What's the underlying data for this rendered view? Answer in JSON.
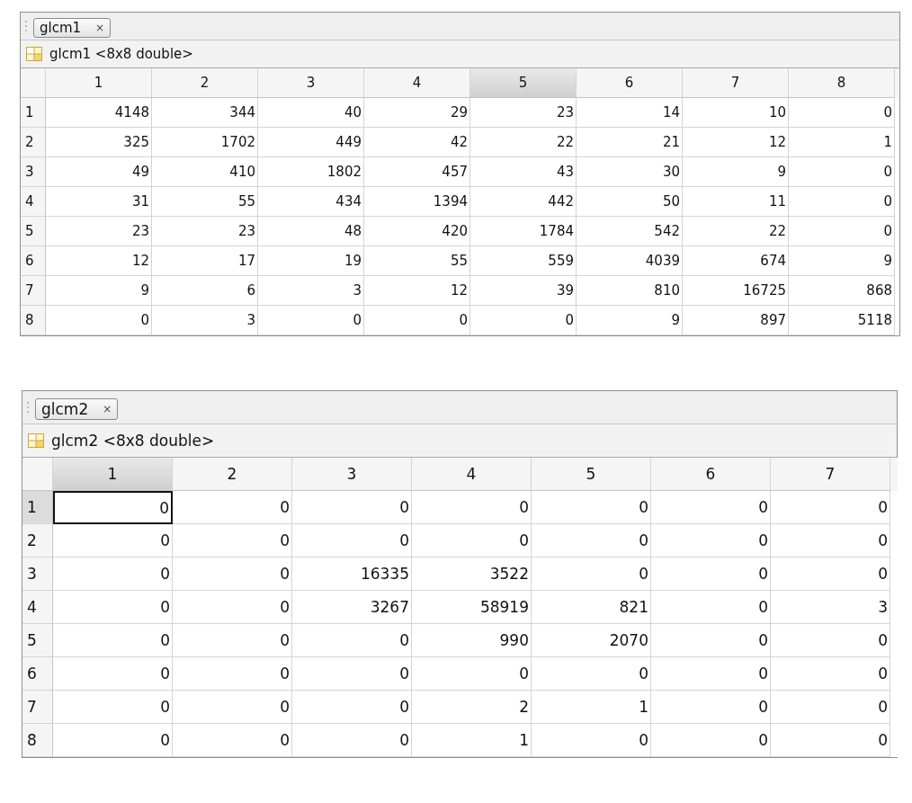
{
  "panels": [
    {
      "tab": {
        "label": "glcm1",
        "close": "×"
      },
      "title": "glcm1 <8x8 double>",
      "columns": [
        {
          "label": "1",
          "selected": false
        },
        {
          "label": "2",
          "selected": false
        },
        {
          "label": "3",
          "selected": false
        },
        {
          "label": "4",
          "selected": false
        },
        {
          "label": "5",
          "selected": true
        },
        {
          "label": "6",
          "selected": false
        },
        {
          "label": "7",
          "selected": false
        },
        {
          "label": "8",
          "selected": false
        }
      ],
      "rows": [
        {
          "label": "1",
          "selected": false,
          "cells": [
            {
              "value": "4148",
              "selected": false
            },
            {
              "value": "344",
              "selected": false
            },
            {
              "value": "40",
              "selected": false
            },
            {
              "value": "29",
              "selected": false
            },
            {
              "value": "23",
              "selected": false
            },
            {
              "value": "14",
              "selected": false
            },
            {
              "value": "10",
              "selected": false
            },
            {
              "value": "0",
              "selected": false
            }
          ]
        },
        {
          "label": "2",
          "selected": false,
          "cells": [
            {
              "value": "325",
              "selected": false
            },
            {
              "value": "1702",
              "selected": false
            },
            {
              "value": "449",
              "selected": false
            },
            {
              "value": "42",
              "selected": false
            },
            {
              "value": "22",
              "selected": false
            },
            {
              "value": "21",
              "selected": false
            },
            {
              "value": "12",
              "selected": false
            },
            {
              "value": "1",
              "selected": false
            }
          ]
        },
        {
          "label": "3",
          "selected": false,
          "cells": [
            {
              "value": "49",
              "selected": false
            },
            {
              "value": "410",
              "selected": false
            },
            {
              "value": "1802",
              "selected": false
            },
            {
              "value": "457",
              "selected": false
            },
            {
              "value": "43",
              "selected": false
            },
            {
              "value": "30",
              "selected": false
            },
            {
              "value": "9",
              "selected": false
            },
            {
              "value": "0",
              "selected": false
            }
          ]
        },
        {
          "label": "4",
          "selected": false,
          "cells": [
            {
              "value": "31",
              "selected": false
            },
            {
              "value": "55",
              "selected": false
            },
            {
              "value": "434",
              "selected": false
            },
            {
              "value": "1394",
              "selected": false
            },
            {
              "value": "442",
              "selected": false
            },
            {
              "value": "50",
              "selected": false
            },
            {
              "value": "11",
              "selected": false
            },
            {
              "value": "0",
              "selected": false
            }
          ]
        },
        {
          "label": "5",
          "selected": false,
          "cells": [
            {
              "value": "23",
              "selected": false
            },
            {
              "value": "23",
              "selected": false
            },
            {
              "value": "48",
              "selected": false
            },
            {
              "value": "420",
              "selected": false
            },
            {
              "value": "1784",
              "selected": false
            },
            {
              "value": "542",
              "selected": false
            },
            {
              "value": "22",
              "selected": false
            },
            {
              "value": "0",
              "selected": false
            }
          ]
        },
        {
          "label": "6",
          "selected": false,
          "cells": [
            {
              "value": "12",
              "selected": false
            },
            {
              "value": "17",
              "selected": false
            },
            {
              "value": "19",
              "selected": false
            },
            {
              "value": "55",
              "selected": false
            },
            {
              "value": "559",
              "selected": false
            },
            {
              "value": "4039",
              "selected": false
            },
            {
              "value": "674",
              "selected": false
            },
            {
              "value": "9",
              "selected": false
            }
          ]
        },
        {
          "label": "7",
          "selected": false,
          "cells": [
            {
              "value": "9",
              "selected": false
            },
            {
              "value": "6",
              "selected": false
            },
            {
              "value": "3",
              "selected": false
            },
            {
              "value": "12",
              "selected": false
            },
            {
              "value": "39",
              "selected": false
            },
            {
              "value": "810",
              "selected": false
            },
            {
              "value": "16725",
              "selected": false
            },
            {
              "value": "868",
              "selected": false
            }
          ]
        },
        {
          "label": "8",
          "selected": false,
          "cells": [
            {
              "value": "0",
              "selected": false
            },
            {
              "value": "3",
              "selected": false
            },
            {
              "value": "0",
              "selected": false
            },
            {
              "value": "0",
              "selected": false
            },
            {
              "value": "0",
              "selected": false
            },
            {
              "value": "9",
              "selected": false
            },
            {
              "value": "897",
              "selected": false
            },
            {
              "value": "5118",
              "selected": false
            }
          ]
        }
      ]
    },
    {
      "tab": {
        "label": "glcm2",
        "close": "×"
      },
      "title": "glcm2 <8x8 double>",
      "columns": [
        {
          "label": "1",
          "selected": true
        },
        {
          "label": "2",
          "selected": false
        },
        {
          "label": "3",
          "selected": false
        },
        {
          "label": "4",
          "selected": false
        },
        {
          "label": "5",
          "selected": false
        },
        {
          "label": "6",
          "selected": false
        },
        {
          "label": "7",
          "selected": false
        }
      ],
      "rows": [
        {
          "label": "1",
          "selected": true,
          "cells": [
            {
              "value": "0",
              "selected": true
            },
            {
              "value": "0",
              "selected": false
            },
            {
              "value": "0",
              "selected": false
            },
            {
              "value": "0",
              "selected": false
            },
            {
              "value": "0",
              "selected": false
            },
            {
              "value": "0",
              "selected": false
            },
            {
              "value": "0",
              "selected": false
            }
          ]
        },
        {
          "label": "2",
          "selected": false,
          "cells": [
            {
              "value": "0",
              "selected": false
            },
            {
              "value": "0",
              "selected": false
            },
            {
              "value": "0",
              "selected": false
            },
            {
              "value": "0",
              "selected": false
            },
            {
              "value": "0",
              "selected": false
            },
            {
              "value": "0",
              "selected": false
            },
            {
              "value": "0",
              "selected": false
            }
          ]
        },
        {
          "label": "3",
          "selected": false,
          "cells": [
            {
              "value": "0",
              "selected": false
            },
            {
              "value": "0",
              "selected": false
            },
            {
              "value": "16335",
              "selected": false
            },
            {
              "value": "3522",
              "selected": false
            },
            {
              "value": "0",
              "selected": false
            },
            {
              "value": "0",
              "selected": false
            },
            {
              "value": "0",
              "selected": false
            }
          ]
        },
        {
          "label": "4",
          "selected": false,
          "cells": [
            {
              "value": "0",
              "selected": false
            },
            {
              "value": "0",
              "selected": false
            },
            {
              "value": "3267",
              "selected": false
            },
            {
              "value": "58919",
              "selected": false
            },
            {
              "value": "821",
              "selected": false
            },
            {
              "value": "0",
              "selected": false
            },
            {
              "value": "3",
              "selected": false
            }
          ]
        },
        {
          "label": "5",
          "selected": false,
          "cells": [
            {
              "value": "0",
              "selected": false
            },
            {
              "value": "0",
              "selected": false
            },
            {
              "value": "0",
              "selected": false
            },
            {
              "value": "990",
              "selected": false
            },
            {
              "value": "2070",
              "selected": false
            },
            {
              "value": "0",
              "selected": false
            },
            {
              "value": "0",
              "selected": false
            }
          ]
        },
        {
          "label": "6",
          "selected": false,
          "cells": [
            {
              "value": "0",
              "selected": false
            },
            {
              "value": "0",
              "selected": false
            },
            {
              "value": "0",
              "selected": false
            },
            {
              "value": "0",
              "selected": false
            },
            {
              "value": "0",
              "selected": false
            },
            {
              "value": "0",
              "selected": false
            },
            {
              "value": "0",
              "selected": false
            }
          ]
        },
        {
          "label": "7",
          "selected": false,
          "cells": [
            {
              "value": "0",
              "selected": false
            },
            {
              "value": "0",
              "selected": false
            },
            {
              "value": "0",
              "selected": false
            },
            {
              "value": "2",
              "selected": false
            },
            {
              "value": "1",
              "selected": false
            },
            {
              "value": "0",
              "selected": false
            },
            {
              "value": "0",
              "selected": false
            }
          ]
        },
        {
          "label": "8",
          "selected": false,
          "cells": [
            {
              "value": "0",
              "selected": false
            },
            {
              "value": "0",
              "selected": false
            },
            {
              "value": "0",
              "selected": false
            },
            {
              "value": "1",
              "selected": false
            },
            {
              "value": "0",
              "selected": false
            },
            {
              "value": "0",
              "selected": false
            },
            {
              "value": "0",
              "selected": false
            }
          ]
        }
      ]
    }
  ]
}
